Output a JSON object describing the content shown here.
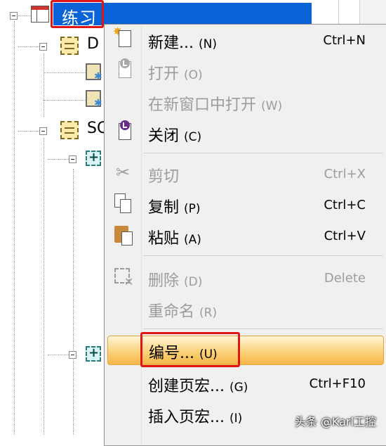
{
  "tree": {
    "root_label": "练习",
    "node_d_prefix": "D",
    "node_s_prefix": "SC"
  },
  "context_menu": {
    "items": [
      {
        "label": "新建...",
        "hotkey": "(N)",
        "shortcut": "Ctrl+N",
        "enabled": true,
        "icon": "new-document-icon"
      },
      {
        "label": "打开",
        "hotkey": "(O)",
        "shortcut": "",
        "enabled": false,
        "icon": "open-icon"
      },
      {
        "label": "在新窗口中打开",
        "hotkey": "(W)",
        "shortcut": "",
        "enabled": false,
        "icon": ""
      },
      {
        "label": "关闭",
        "hotkey": "(C)",
        "shortcut": "",
        "enabled": true,
        "icon": "close-document-icon"
      },
      {
        "label": "剪切",
        "hotkey": "",
        "shortcut": "Ctrl+X",
        "enabled": false,
        "icon": "scissors-icon"
      },
      {
        "label": "复制",
        "hotkey": "(P)",
        "shortcut": "Ctrl+C",
        "enabled": true,
        "icon": "copy-icon"
      },
      {
        "label": "粘贴",
        "hotkey": "(A)",
        "shortcut": "Ctrl+V",
        "enabled": true,
        "icon": "paste-icon"
      },
      {
        "label": "删除",
        "hotkey": "(D)",
        "shortcut": "Delete",
        "enabled": false,
        "icon": "delete-icon"
      },
      {
        "label": "重命名",
        "hotkey": "(R)",
        "shortcut": "",
        "enabled": false,
        "icon": ""
      },
      {
        "label": "编号...",
        "hotkey": "(U)",
        "shortcut": "",
        "enabled": true,
        "icon": "",
        "highlighted": true
      },
      {
        "label": "创建页宏...",
        "hotkey": "(G)",
        "shortcut": "Ctrl+F10",
        "enabled": true,
        "icon": ""
      },
      {
        "label": "插入页宏...",
        "hotkey": "(I)",
        "shortcut": "",
        "enabled": true,
        "icon": ""
      }
    ]
  },
  "watermark": "头条 @Karl工控",
  "colors": {
    "selection": "#0a63d6",
    "menu_bg": "#f0f0f0",
    "highlight": "#fbd27a",
    "annotation_red": "#e01515",
    "disabled_text": "#9c9c9c"
  }
}
